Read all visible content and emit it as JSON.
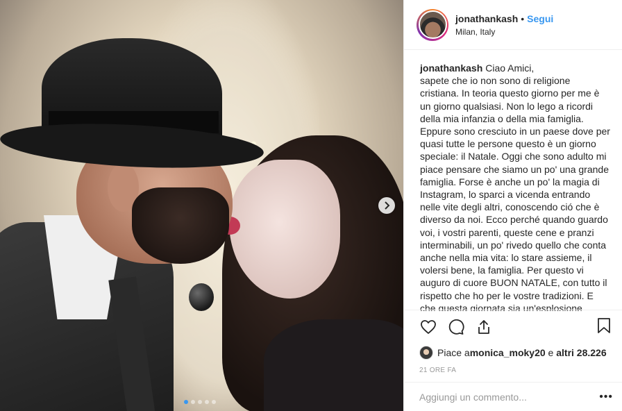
{
  "header": {
    "username": "jonathankash",
    "separator": "•",
    "follow_label": "Segui",
    "location": "Milan, Italy"
  },
  "caption": {
    "username": "jonathankash",
    "text": "Ciao Amici,\nsapete che io non sono di religione cristiana. In teoria questo giorno per me è un giorno qualsiasi. Non lo lego a ricordi della mia infanzia o della mia famiglia. Eppure sono cresciuto in un paese dove per quasi tutte le persone questo è un giorno speciale: il Natale. Oggi che sono adulto mi piace pensare che siamo un po' una grande famiglia. Forse è anche un po' la magia di Instagram, lo sparci a vicenda entrando nelle vite degli altri, conoscendo ció che è diverso da noi. Ecco perché quando guardo voi, i vostri parenti, queste cene e pranzi interminabili, un po' rivedo quello che conta anche nella mia vita: lo stare assieme, il volersi bene, la famiglia. Per questo vi auguro di cuore BUON NATALE, con tutto il rispetto che ho per le vostre tradizioni. E che questa giornata sia un'esplosione"
  },
  "actions": {
    "like_icon": "heart-icon",
    "comment_icon": "comment-icon",
    "share_icon": "share-icon",
    "save_icon": "bookmark-icon"
  },
  "likes": {
    "prefix": "Piace a ",
    "user": "monica_moky20",
    "middle": " e ",
    "others": "altri 28.226"
  },
  "timestamp": "21 ORE FA",
  "comment": {
    "placeholder": "Aggiungi un commento...",
    "more_label": "•••"
  },
  "carousel": {
    "slide_count": 5,
    "active_index": 0
  },
  "colors": {
    "accent": "#3897f0",
    "text": "#262626",
    "muted": "#999999",
    "border": "#efefef"
  }
}
